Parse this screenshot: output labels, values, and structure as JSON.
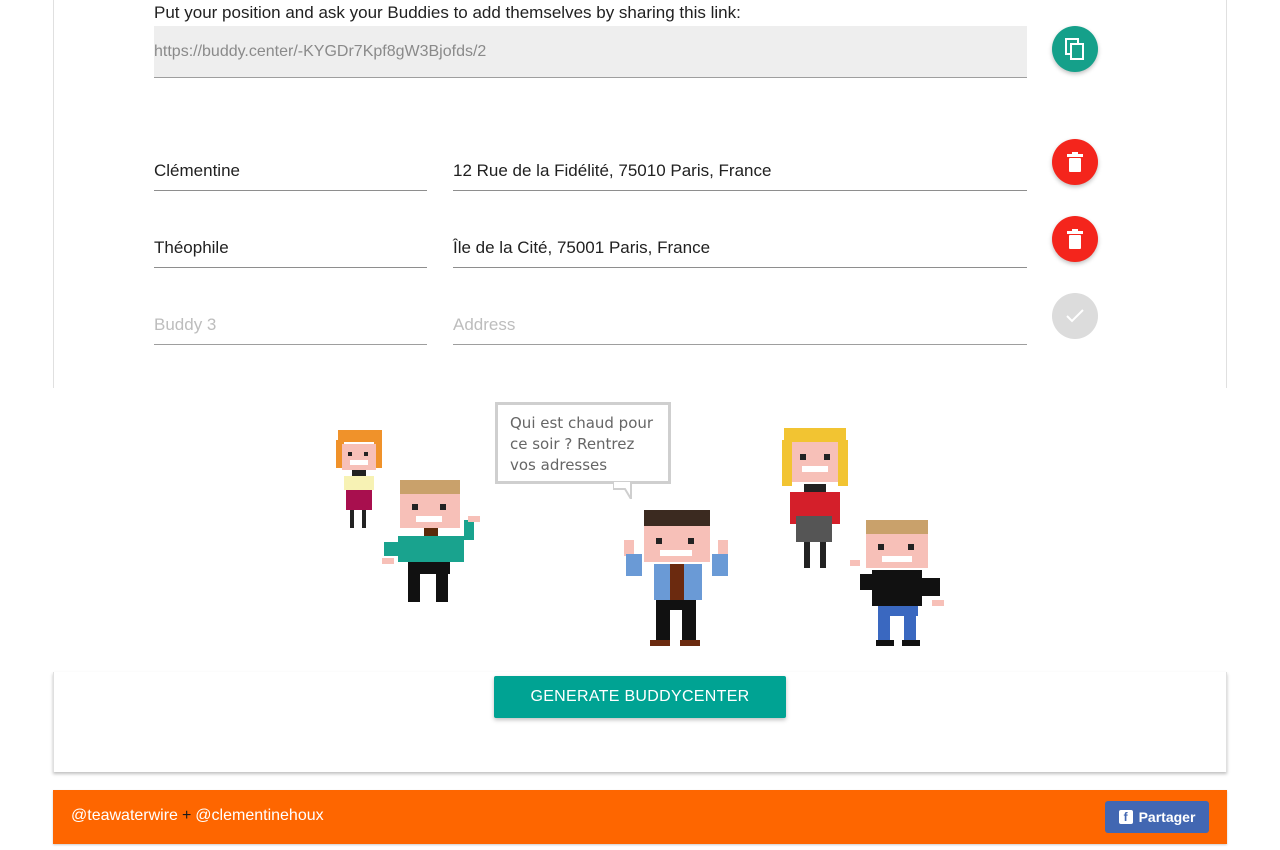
{
  "share": {
    "label": "Put your position and ask your Buddies to add themselves by sharing this link:",
    "link": "https://buddy.center/-KYGDr7Kpf8gW3Bjofds/2",
    "copy_icon": "copy-icon"
  },
  "buddies": [
    {
      "name": "Clémentine",
      "address": "12 Rue de la Fidélité, 75010 Paris, France",
      "action_icon": "delete-icon"
    },
    {
      "name": "Théophile",
      "address": "Île de la Cité, 75001 Paris, France",
      "action_icon": "delete-icon"
    }
  ],
  "new_buddy": {
    "name_placeholder": "Buddy 3",
    "address_placeholder": "Address",
    "action_icon": "check-icon"
  },
  "illustration": {
    "speech_bubble": "Qui est chaud pour ce soir ? Rentrez vos adresses"
  },
  "generate_button": "GENERATE BUDDYCENTER",
  "footer": {
    "credit_1": "@teawaterwire",
    "separator": "+",
    "credit_2": "@clementinehoux",
    "share_button": "Partager"
  },
  "colors": {
    "copy_button": "#15a08a",
    "delete_button": "#f4251c",
    "generate_button": "#00a393",
    "footer": "#fe6600",
    "facebook": "#4267b2"
  }
}
